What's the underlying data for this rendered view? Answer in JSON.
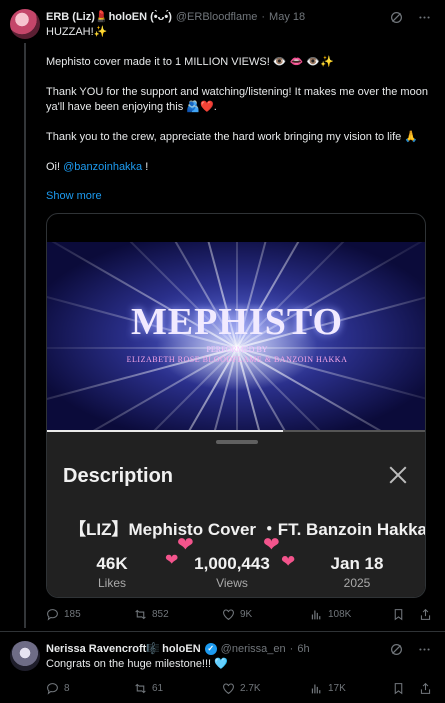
{
  "tweet1": {
    "name": "ERB (Liz)💄holoEN (•̀ᴗ•́)",
    "handle": "@ERBloodflame",
    "sep": "·",
    "time": "May 18",
    "lines": [
      "HUZZAH!✨",
      "Mephisto cover made it to 1 MILLION VIEWS! 👁️ 👄 👁️✨",
      "Thank YOU for the support and watching/listening! It makes me over the moon ya'll have been enjoying this 🫂❤️.",
      "Thank you to the crew, appreciate the hard work bringing my vision to life 🙏",
      "Oi!"
    ],
    "mention": "@banzoinhakka",
    "mention_suffix": " !",
    "show_more": "Show more",
    "media": {
      "video_title_art": "MEPHISTO",
      "performed_by": "PERFORMED BY",
      "artists": "ELIZABETH ROSE BLOODFLAME & BANZOIN HAKKA",
      "progress_fraction": 0.62,
      "description_header": "Description",
      "video_title": "【LIZ】Mephisto Cover ・FT. Banzoin Hakka",
      "stats": [
        {
          "value": "46K",
          "label": "Likes"
        },
        {
          "value": "1,000,443",
          "label": "Views"
        },
        {
          "value": "Jan 18",
          "label": "2025"
        }
      ]
    },
    "actions": {
      "replies": "185",
      "reposts": "852",
      "likes": "9K",
      "views": "108K"
    }
  },
  "tweet2": {
    "name": "Nerissa Ravencroft🎼 holoEN",
    "handle": "@nerissa_en",
    "sep": "·",
    "time": "6h",
    "text": "Congrats on the huge milestone!!! 🩵",
    "actions": {
      "replies": "8",
      "reposts": "61",
      "likes": "2.7K",
      "views": "17K"
    }
  },
  "colors": {
    "accent": "#1d9bf0",
    "muted": "#71767b",
    "background": "#000000",
    "heart": "#f3548c"
  }
}
